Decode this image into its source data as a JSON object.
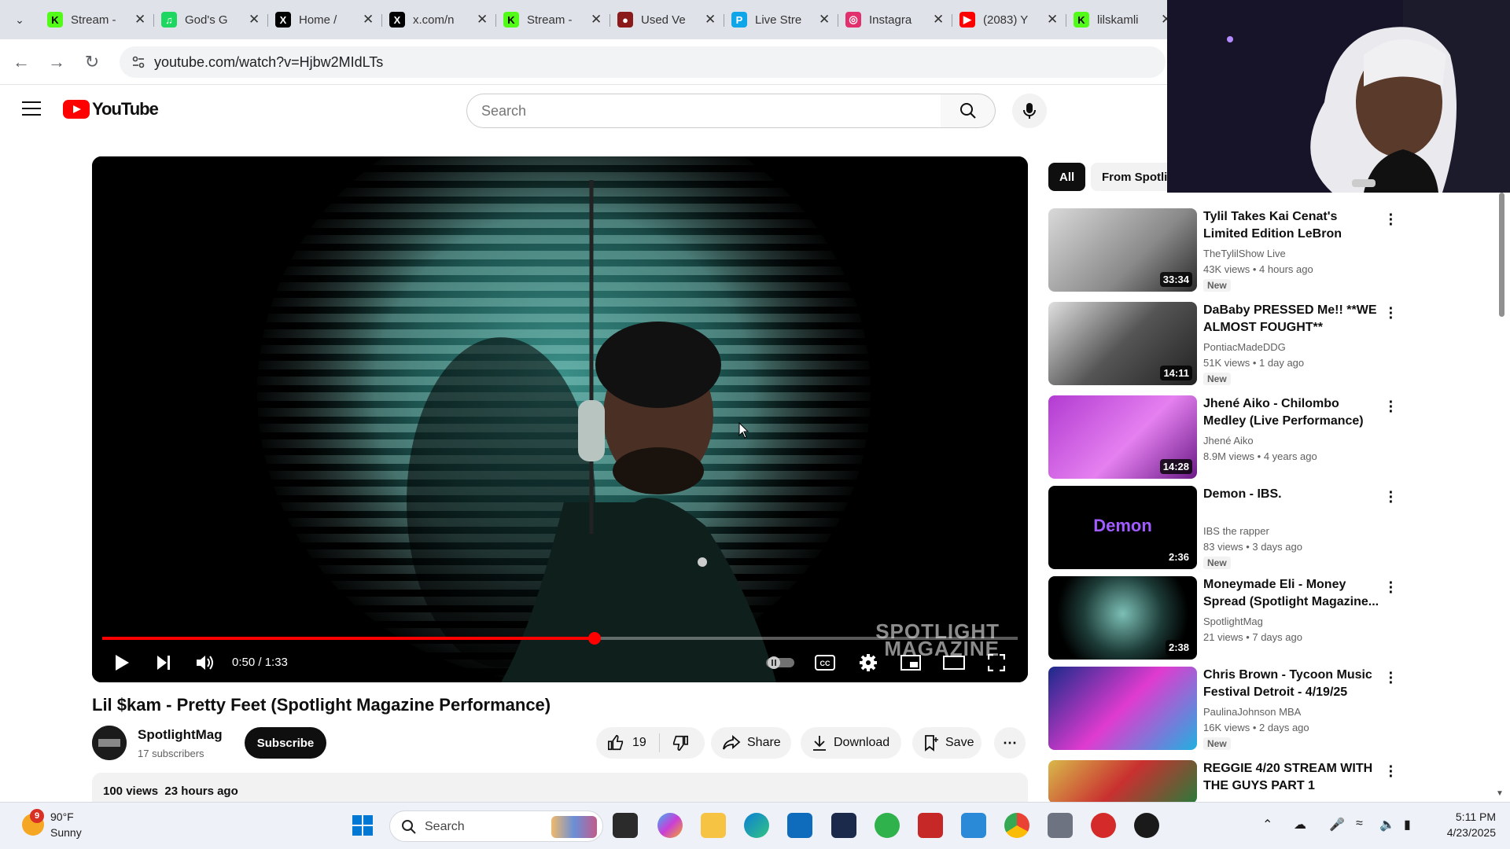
{
  "browser": {
    "tabs": [
      {
        "title": "Stream -",
        "icon": "kick-icon",
        "color": "#53fc18"
      },
      {
        "title": "God's G",
        "icon": "spotify-icon",
        "color": "#1ed760"
      },
      {
        "title": "Home /",
        "icon": "x-icon",
        "color": "#000000"
      },
      {
        "title": "x.com/n",
        "icon": "x-icon",
        "color": "#000000"
      },
      {
        "title": "Stream -",
        "icon": "kick-icon",
        "color": "#53fc18"
      },
      {
        "title": "Used Ve",
        "icon": "car-site-icon",
        "color": "#8b1a1a"
      },
      {
        "title": "Live Stre",
        "icon": "p-site-icon",
        "color": "#0ea5e9"
      },
      {
        "title": "Instagra",
        "icon": "instagram-icon",
        "color": "#e1306c"
      },
      {
        "title": "(2083) Y",
        "icon": "youtube-icon",
        "color": "#ff0000"
      },
      {
        "title": "lilskamli",
        "icon": "kick-icon",
        "color": "#53fc18"
      }
    ],
    "url": "youtube.com/watch?v=Hjbw2MIdLTs"
  },
  "youtube": {
    "logo_text": "YouTube",
    "search_placeholder": "Search",
    "video": {
      "title": "Lil $kam - Pretty Feet (Spotlight Magazine Performance)",
      "time_current": "0:50",
      "time_total": "1:33",
      "time_display": "0:50 / 1:33",
      "progress_fraction": 0.538,
      "watermark_line1": "SPOTLIGHT",
      "watermark_line2": "MAGAZINE"
    },
    "channel": {
      "name": "SpotlightMag",
      "subscribers": "17 subscribers",
      "subscribe_label": "Subscribe"
    },
    "actions": {
      "likes": "19",
      "share": "Share",
      "download": "Download",
      "save": "Save"
    },
    "description": {
      "views": "100 views",
      "age": "23 hours ago"
    },
    "chips": [
      "All",
      "From Spotlight"
    ],
    "recommendations": [
      {
        "title": "Tylil Takes Kai Cenat's Limited Edition LeBron James Barbie...",
        "channel": "TheTylilShow Live",
        "views": "43K views",
        "age": "4 hours ago",
        "duration": "33:34",
        "new": "New"
      },
      {
        "title": "DaBaby PRESSED Me!! **WE ALMOST FOUGHT**",
        "channel": "PontiacMadeDDG",
        "views": "51K views",
        "age": "1 day ago",
        "duration": "14:11",
        "new": "New"
      },
      {
        "title": "Jhené Aiko - Chilombo Medley (Live Performance)",
        "channel": "Jhené Aiko",
        "views": "8.9M views",
        "age": "4 years ago",
        "duration": "14:28",
        "new": ""
      },
      {
        "title": "Demon - IBS.",
        "channel": "IBS the rapper",
        "views": "83 views",
        "age": "3 days ago",
        "duration": "2:36",
        "new": "New",
        "thumb_text": "Demon"
      },
      {
        "title": "Moneymade Eli - Money Spread (Spotlight Magazine...",
        "channel": "SpotlightMag",
        "views": "21 views",
        "age": "7 days ago",
        "duration": "2:38",
        "new": ""
      },
      {
        "title": "Chris Brown - Tycoon Music Festival Detroit - 4/19/25",
        "channel": "PaulinaJohnson MBA",
        "views": "16K views",
        "age": "2 days ago",
        "duration": "",
        "new": "New"
      },
      {
        "title": "REGGIE 4/20 STREAM WITH THE GUYS PART 1",
        "channel": "",
        "views": "",
        "age": "",
        "duration": "",
        "new": ""
      }
    ]
  },
  "taskbar": {
    "weather_temp": "90°F",
    "weather_cond": "Sunny",
    "weather_badge": "9",
    "search_label": "Search",
    "time": "5:11 PM",
    "date": "4/23/2025"
  }
}
